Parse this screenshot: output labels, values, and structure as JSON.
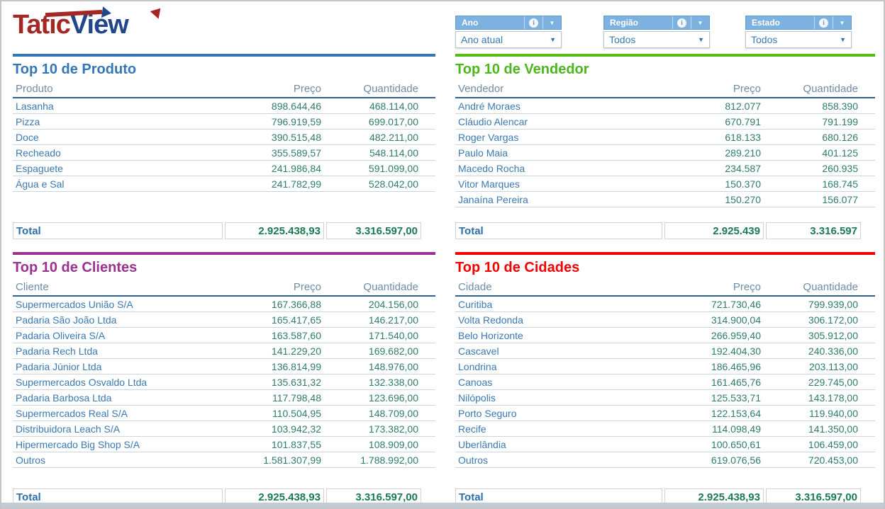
{
  "brand": {
    "part1": "Tatic",
    "part2": "View"
  },
  "colors": {
    "brand_red": "#a32824",
    "brand_blue": "#20468c",
    "filter_header_blue": "#7db1e0",
    "produto_accent": "#3377b6",
    "vendedor_accent": "#55bd12",
    "clientes_accent": "#9b3191",
    "cidades_accent": "#f40000"
  },
  "filters": [
    {
      "label": "Ano",
      "value": "Ano atual",
      "info_icon": "i",
      "caret_icon": "▼"
    },
    {
      "label": "Região",
      "value": "Todos",
      "info_icon": "i",
      "caret_icon": "▼"
    },
    {
      "label": "Estado",
      "value": "Todos",
      "info_icon": "i",
      "caret_icon": "▼"
    }
  ],
  "panels": [
    {
      "title": "Top 10 de Produto",
      "accent": "#3377b6",
      "title_color": "#3377b6",
      "columns": [
        "Produto",
        "Preço",
        "Quantidade"
      ],
      "rows": [
        [
          "Lasanha",
          "898.644,46",
          "468.114,00"
        ],
        [
          "Pizza",
          "796.919,59",
          "699.017,00"
        ],
        [
          "Doce",
          "390.515,48",
          "482.211,00"
        ],
        [
          "Recheado",
          "355.589,57",
          "548.114,00"
        ],
        [
          "Espaguete",
          "241.986,84",
          "591.099,00"
        ],
        [
          "Água e Sal",
          "241.782,99",
          "528.042,00"
        ]
      ],
      "total": {
        "label": "Total",
        "preco": "2.925.438,93",
        "qtd": "3.316.597,00"
      }
    },
    {
      "title": "Top 10 de Vendedor",
      "accent": "#55bd12",
      "title_color": "#4cb71b",
      "columns": [
        "Vendedor",
        "Preço",
        "Quantidade"
      ],
      "rows": [
        [
          "André Moraes",
          "812.077",
          "858.390"
        ],
        [
          "Cláudio Alencar",
          "670.791",
          "791.199"
        ],
        [
          "Roger Vargas",
          "618.133",
          "680.126"
        ],
        [
          "Paulo Maia",
          "289.210",
          "401.125"
        ],
        [
          "Macedo Rocha",
          "234.587",
          "260.935"
        ],
        [
          "Vitor Marques",
          "150.370",
          "168.745"
        ],
        [
          "Janaína Pereira",
          "150.270",
          "156.077"
        ]
      ],
      "total": {
        "label": "Total",
        "preco": "2.925.439",
        "qtd": "3.316.597"
      }
    },
    {
      "title": "Top 10 de Clientes",
      "accent": "#9b3191",
      "title_color": "#9b3191",
      "columns": [
        "Cliente",
        "Preço",
        "Quantidade"
      ],
      "rows": [
        [
          "Supermercados União S/A",
          "167.366,88",
          "204.156,00"
        ],
        [
          "Padaria São João Ltda",
          "165.417,65",
          "146.217,00"
        ],
        [
          "Padaria Oliveira S/A",
          "163.587,60",
          "171.540,00"
        ],
        [
          "Padaria Rech Ltda",
          "141.229,20",
          "169.682,00"
        ],
        [
          "Padaria Júnior Ltda",
          "136.814,99",
          "148.976,00"
        ],
        [
          "Supermercados Osvaldo Ltda",
          "135.631,32",
          "132.338,00"
        ],
        [
          "Padaria Barbosa Ltda",
          "117.798,48",
          "123.696,00"
        ],
        [
          "Supermercados Real S/A",
          "110.504,95",
          "148.709,00"
        ],
        [
          "Distribuidora Leach S/A",
          "103.942,32",
          "173.382,00"
        ],
        [
          "Hipermercado Big Shop S/A",
          "101.837,55",
          "108.909,00"
        ],
        [
          "Outros",
          "1.581.307,99",
          "1.788.992,00"
        ]
      ],
      "total": {
        "label": "Total",
        "preco": "2.925.438,93",
        "qtd": "3.316.597,00"
      }
    },
    {
      "title": "Top 10 de Cidades",
      "accent": "#f40000",
      "title_color": "#f40000",
      "columns": [
        "Cidade",
        "Preço",
        "Quantidade"
      ],
      "rows": [
        [
          "Curitiba",
          "721.730,46",
          "799.939,00"
        ],
        [
          "Volta Redonda",
          "314.900,04",
          "306.172,00"
        ],
        [
          "Belo Horizonte",
          "266.959,40",
          "305.912,00"
        ],
        [
          "Cascavel",
          "192.404,30",
          "240.336,00"
        ],
        [
          "Londrina",
          "186.465,96",
          "203.113,00"
        ],
        [
          "Canoas",
          "161.465,76",
          "229.745,00"
        ],
        [
          "Nilópolis",
          "125.533,71",
          "143.178,00"
        ],
        [
          "Porto Seguro",
          "122.153,64",
          "119.940,00"
        ],
        [
          "Recife",
          "114.098,49",
          "141.350,00"
        ],
        [
          "Uberlândia",
          "100.650,61",
          "106.459,00"
        ],
        [
          "Outros",
          "619.076,56",
          "720.453,00"
        ]
      ],
      "total": {
        "label": "Total",
        "preco": "2.925.438,93",
        "qtd": "3.316.597,00"
      }
    }
  ]
}
